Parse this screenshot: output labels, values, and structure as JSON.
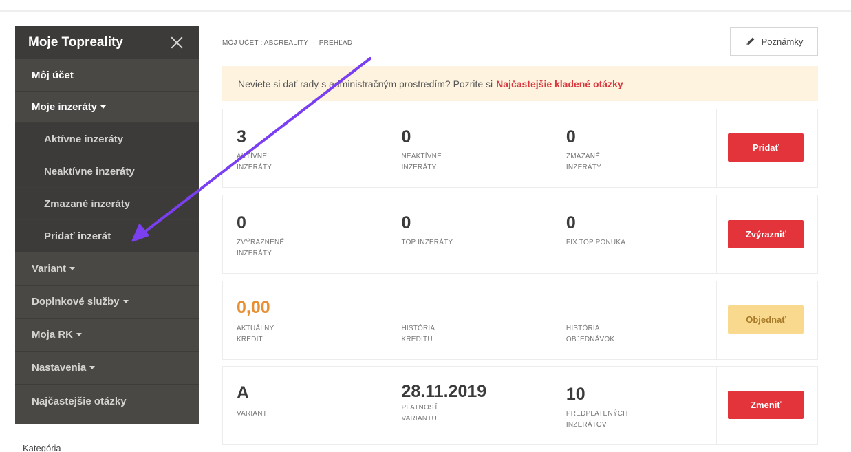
{
  "sidebar": {
    "title": "Moje Topreality",
    "items": [
      {
        "label": "Môj účet"
      },
      {
        "label": "Moje inzeráty"
      },
      {
        "label": "Aktívne inzeráty"
      },
      {
        "label": "Neaktívne inzeráty"
      },
      {
        "label": "Zmazané inzeráty"
      },
      {
        "label": "Pridať inzerát"
      },
      {
        "label": "Variant"
      },
      {
        "label": "Doplnkové služby"
      },
      {
        "label": "Moja RK"
      },
      {
        "label": "Nastavenia"
      },
      {
        "label": "Najčastejšie otázky"
      }
    ],
    "footer_label": "Kategória"
  },
  "breadcrumb": {
    "part1": "MÔJ ÚČET : ABCREALITY",
    "separator": "·",
    "part2": "PREHĽAD"
  },
  "notes_button": {
    "label": "Poznámky"
  },
  "info_bar": {
    "text": "Neviete si dať rady s administračným prostredím? Pozrite si",
    "link": "Najčastejšie kladené otázky"
  },
  "rows": [
    {
      "cells": [
        {
          "value": "3",
          "label1": "AKTÍVNE",
          "label2": "INZERÁTY"
        },
        {
          "value": "0",
          "label1": "NEAKTÍVNE",
          "label2": "INZERÁTY"
        },
        {
          "value": "0",
          "label1": "ZMAZANÉ",
          "label2": "INZERÁTY"
        }
      ],
      "button": "Pridať"
    },
    {
      "cells": [
        {
          "value": "0",
          "label1": "ZVÝRAZNENÉ",
          "label2": "INZERÁTY"
        },
        {
          "value": "0",
          "label1": "TOP INZERÁTY",
          "label2": ""
        },
        {
          "value": "0",
          "label1": "FIX TOP PONUKA",
          "label2": ""
        }
      ],
      "button": "Zvýrazniť"
    },
    {
      "cells": [
        {
          "value": "0,00",
          "label1": "AKTUÁLNY",
          "label2": "KREDIT"
        },
        {
          "value": "",
          "label1": "HISTÓRIA",
          "label2": "KREDITU"
        },
        {
          "value": "",
          "label1": "HISTÓRIA",
          "label2": "OBJEDNÁVOK"
        }
      ],
      "button": "Objednať"
    },
    {
      "cells": [
        {
          "value": "A",
          "label1": "VARIANT",
          "label2": ""
        },
        {
          "value": "28.11.2019",
          "label1": "PLATNOSŤ",
          "label2": "VARIANTU"
        },
        {
          "value": "10",
          "label1": "PREDPLATENÝCH",
          "label2": "INZERÁTOV"
        }
      ],
      "button": "Zmeniť"
    }
  ],
  "colors": {
    "sidebar_bg": "#4a4845",
    "accent_red": "#e3333b",
    "credit_orange": "#e88f34",
    "info_bg": "#fdf3df",
    "arrow": "#7b3ff2"
  }
}
